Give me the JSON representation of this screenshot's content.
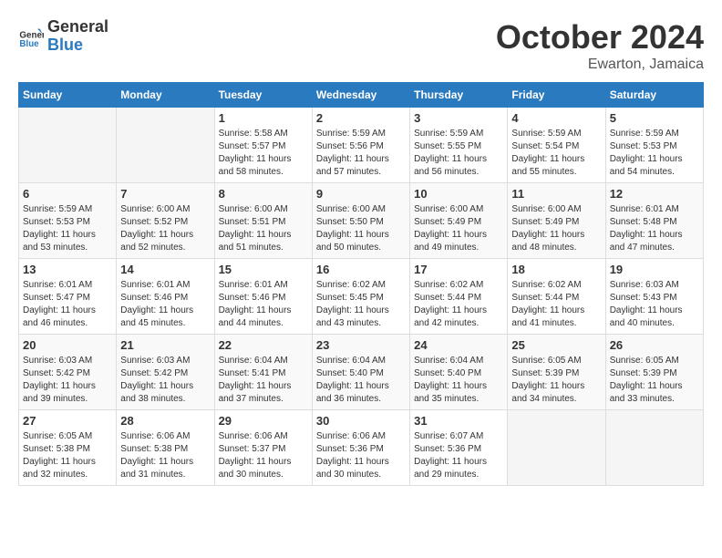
{
  "header": {
    "logo_line1": "General",
    "logo_line2": "Blue",
    "month_title": "October 2024",
    "location": "Ewarton, Jamaica"
  },
  "days_of_week": [
    "Sunday",
    "Monday",
    "Tuesday",
    "Wednesday",
    "Thursday",
    "Friday",
    "Saturday"
  ],
  "weeks": [
    [
      {
        "day": "",
        "info": ""
      },
      {
        "day": "",
        "info": ""
      },
      {
        "day": "1",
        "info": "Sunrise: 5:58 AM\nSunset: 5:57 PM\nDaylight: 11 hours and 58 minutes."
      },
      {
        "day": "2",
        "info": "Sunrise: 5:59 AM\nSunset: 5:56 PM\nDaylight: 11 hours and 57 minutes."
      },
      {
        "day": "3",
        "info": "Sunrise: 5:59 AM\nSunset: 5:55 PM\nDaylight: 11 hours and 56 minutes."
      },
      {
        "day": "4",
        "info": "Sunrise: 5:59 AM\nSunset: 5:54 PM\nDaylight: 11 hours and 55 minutes."
      },
      {
        "day": "5",
        "info": "Sunrise: 5:59 AM\nSunset: 5:53 PM\nDaylight: 11 hours and 54 minutes."
      }
    ],
    [
      {
        "day": "6",
        "info": "Sunrise: 5:59 AM\nSunset: 5:53 PM\nDaylight: 11 hours and 53 minutes."
      },
      {
        "day": "7",
        "info": "Sunrise: 6:00 AM\nSunset: 5:52 PM\nDaylight: 11 hours and 52 minutes."
      },
      {
        "day": "8",
        "info": "Sunrise: 6:00 AM\nSunset: 5:51 PM\nDaylight: 11 hours and 51 minutes."
      },
      {
        "day": "9",
        "info": "Sunrise: 6:00 AM\nSunset: 5:50 PM\nDaylight: 11 hours and 50 minutes."
      },
      {
        "day": "10",
        "info": "Sunrise: 6:00 AM\nSunset: 5:49 PM\nDaylight: 11 hours and 49 minutes."
      },
      {
        "day": "11",
        "info": "Sunrise: 6:00 AM\nSunset: 5:49 PM\nDaylight: 11 hours and 48 minutes."
      },
      {
        "day": "12",
        "info": "Sunrise: 6:01 AM\nSunset: 5:48 PM\nDaylight: 11 hours and 47 minutes."
      }
    ],
    [
      {
        "day": "13",
        "info": "Sunrise: 6:01 AM\nSunset: 5:47 PM\nDaylight: 11 hours and 46 minutes."
      },
      {
        "day": "14",
        "info": "Sunrise: 6:01 AM\nSunset: 5:46 PM\nDaylight: 11 hours and 45 minutes."
      },
      {
        "day": "15",
        "info": "Sunrise: 6:01 AM\nSunset: 5:46 PM\nDaylight: 11 hours and 44 minutes."
      },
      {
        "day": "16",
        "info": "Sunrise: 6:02 AM\nSunset: 5:45 PM\nDaylight: 11 hours and 43 minutes."
      },
      {
        "day": "17",
        "info": "Sunrise: 6:02 AM\nSunset: 5:44 PM\nDaylight: 11 hours and 42 minutes."
      },
      {
        "day": "18",
        "info": "Sunrise: 6:02 AM\nSunset: 5:44 PM\nDaylight: 11 hours and 41 minutes."
      },
      {
        "day": "19",
        "info": "Sunrise: 6:03 AM\nSunset: 5:43 PM\nDaylight: 11 hours and 40 minutes."
      }
    ],
    [
      {
        "day": "20",
        "info": "Sunrise: 6:03 AM\nSunset: 5:42 PM\nDaylight: 11 hours and 39 minutes."
      },
      {
        "day": "21",
        "info": "Sunrise: 6:03 AM\nSunset: 5:42 PM\nDaylight: 11 hours and 38 minutes."
      },
      {
        "day": "22",
        "info": "Sunrise: 6:04 AM\nSunset: 5:41 PM\nDaylight: 11 hours and 37 minutes."
      },
      {
        "day": "23",
        "info": "Sunrise: 6:04 AM\nSunset: 5:40 PM\nDaylight: 11 hours and 36 minutes."
      },
      {
        "day": "24",
        "info": "Sunrise: 6:04 AM\nSunset: 5:40 PM\nDaylight: 11 hours and 35 minutes."
      },
      {
        "day": "25",
        "info": "Sunrise: 6:05 AM\nSunset: 5:39 PM\nDaylight: 11 hours and 34 minutes."
      },
      {
        "day": "26",
        "info": "Sunrise: 6:05 AM\nSunset: 5:39 PM\nDaylight: 11 hours and 33 minutes."
      }
    ],
    [
      {
        "day": "27",
        "info": "Sunrise: 6:05 AM\nSunset: 5:38 PM\nDaylight: 11 hours and 32 minutes."
      },
      {
        "day": "28",
        "info": "Sunrise: 6:06 AM\nSunset: 5:38 PM\nDaylight: 11 hours and 31 minutes."
      },
      {
        "day": "29",
        "info": "Sunrise: 6:06 AM\nSunset: 5:37 PM\nDaylight: 11 hours and 30 minutes."
      },
      {
        "day": "30",
        "info": "Sunrise: 6:06 AM\nSunset: 5:36 PM\nDaylight: 11 hours and 30 minutes."
      },
      {
        "day": "31",
        "info": "Sunrise: 6:07 AM\nSunset: 5:36 PM\nDaylight: 11 hours and 29 minutes."
      },
      {
        "day": "",
        "info": ""
      },
      {
        "day": "",
        "info": ""
      }
    ]
  ]
}
